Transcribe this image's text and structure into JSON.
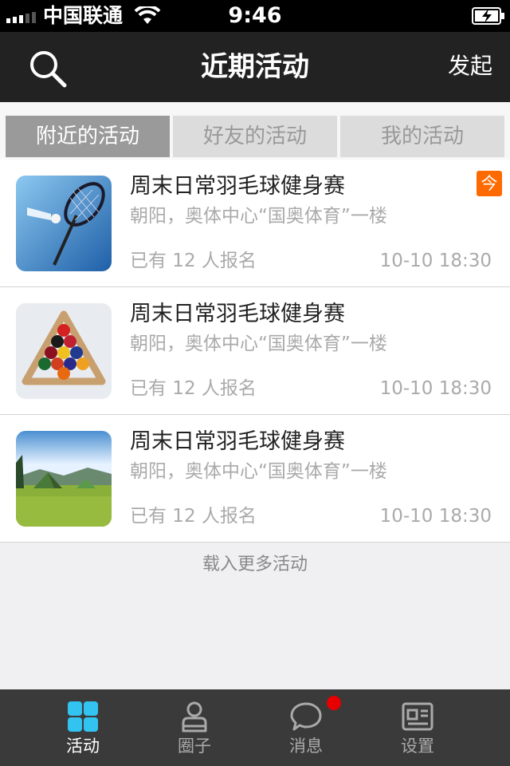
{
  "status_bar": {
    "carrier": "中国联通",
    "time": "9:46"
  },
  "nav": {
    "title": "近期活动",
    "action_label": "发起"
  },
  "tabs": [
    {
      "label": "附近的活动",
      "active": true
    },
    {
      "label": "好友的活动",
      "active": false
    },
    {
      "label": "我的活动",
      "active": false
    }
  ],
  "activities": [
    {
      "title": "周末日常羽毛球健身赛",
      "address": "朝阳，奥体中心“国奥体育”一楼",
      "signup": "已有 12 人报名",
      "time": "10-10 18:30",
      "badge": "今",
      "image": "badminton-icon"
    },
    {
      "title": "周末日常羽毛球健身赛",
      "address": "朝阳，奥体中心“国奥体育”一楼",
      "signup": "已有 12 人报名",
      "time": "10-10 18:30",
      "image": "billiards-icon"
    },
    {
      "title": "周末日常羽毛球健身赛",
      "address": "朝阳，奥体中心“国奥体育”一楼",
      "signup": "已有 12 人报名",
      "time": "10-10 18:30",
      "image": "camping-icon"
    }
  ],
  "load_more": "载入更多活动",
  "tabbar": [
    {
      "label": "活动",
      "icon": "grid-icon",
      "active": true
    },
    {
      "label": "圈子",
      "icon": "profile-icon",
      "active": false
    },
    {
      "label": "消息",
      "icon": "chat-bubble-icon",
      "active": false,
      "has_notification": true
    },
    {
      "label": "设置",
      "icon": "id-card-icon",
      "active": false
    }
  ],
  "colors": {
    "accent": "#33c3f0",
    "badge": "#ff6a00",
    "notification": "#e60000",
    "nav_bg": "#222222"
  }
}
